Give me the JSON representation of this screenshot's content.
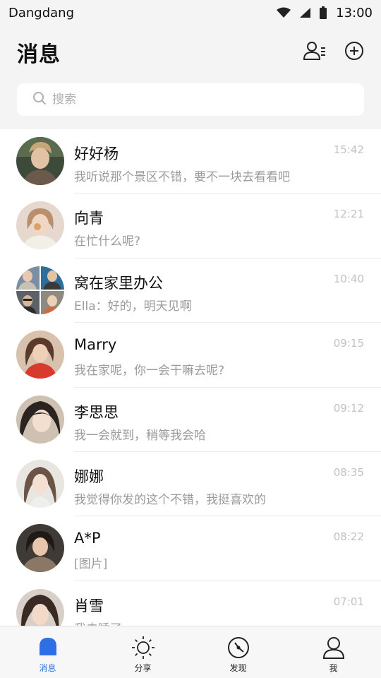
{
  "status_bar": {
    "carrier": "Dangdang",
    "time": "13:00"
  },
  "header": {
    "title": "消息"
  },
  "search": {
    "placeholder": "搜索"
  },
  "conversations": [
    {
      "name": "好好杨",
      "preview": "我听说那个景区不错，要不一块去看看吧",
      "time": "15:42"
    },
    {
      "name": "向青",
      "preview": "在忙什么呢?",
      "time": "12:21"
    },
    {
      "name": "窝在家里办公",
      "preview": "Ella：好的，明天见啊",
      "time": "10:40"
    },
    {
      "name": "Marry",
      "preview": "我在家呢，你一会干嘛去呢?",
      "time": "09:15"
    },
    {
      "name": "李思思",
      "preview": "我一会就到，稍等我会哈",
      "time": "09:12"
    },
    {
      "name": "娜娜",
      "preview": "我觉得你发的这个不错，我挺喜欢的",
      "time": "08:35"
    },
    {
      "name": "A*P",
      "preview": "[图片]",
      "time": "08:22"
    },
    {
      "name": "肖雪",
      "preview": "我去睡了",
      "time": "07:01"
    }
  ],
  "tabs": [
    {
      "label": "消息",
      "icon": "bell-icon",
      "active": true
    },
    {
      "label": "分享",
      "icon": "sun-icon",
      "active": false
    },
    {
      "label": "发现",
      "icon": "compass-icon",
      "active": false
    },
    {
      "label": "我",
      "icon": "person-icon",
      "active": false
    }
  ],
  "colors": {
    "accent": "#2f6fe6",
    "background": "#f4f4f4"
  }
}
